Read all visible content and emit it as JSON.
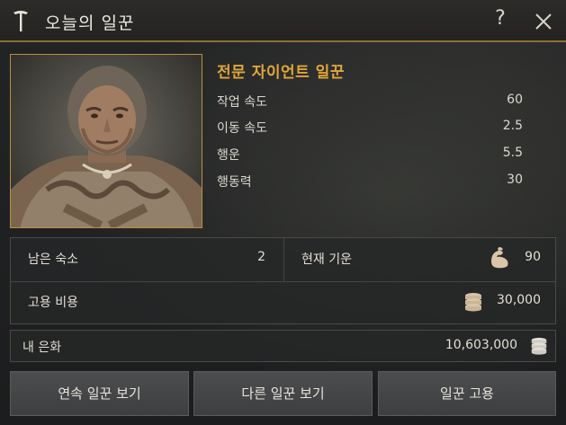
{
  "window": {
    "title": "오늘의 일꾼",
    "help_label": "?"
  },
  "worker": {
    "name": "전문 자이언트 일꾼",
    "stats": [
      {
        "label": "작업 속도",
        "value": "60"
      },
      {
        "label": "이동 속도",
        "value": "2.5"
      },
      {
        "label": "행운",
        "value": "5.5"
      },
      {
        "label": "행동력",
        "value": "30"
      }
    ]
  },
  "info": {
    "lodging_label": "남은 숙소",
    "lodging_value": "2",
    "stamina_label": "현재 기운",
    "stamina_value": "90",
    "cost_label": "고용 비용",
    "cost_value": "30,000"
  },
  "money": {
    "label": "내 은화",
    "value": "10,603,000"
  },
  "buttons": {
    "continuous": "연속 일꾼 보기",
    "other": "다른 일꾼 보기",
    "hire": "일꾼 고용"
  },
  "colors": {
    "accent": "#e0a63a",
    "border_gold": "#b8923a"
  },
  "icons": [
    "worker-title-icon",
    "close-icon",
    "stamina-arm-icon",
    "coin-stack-icon"
  ]
}
